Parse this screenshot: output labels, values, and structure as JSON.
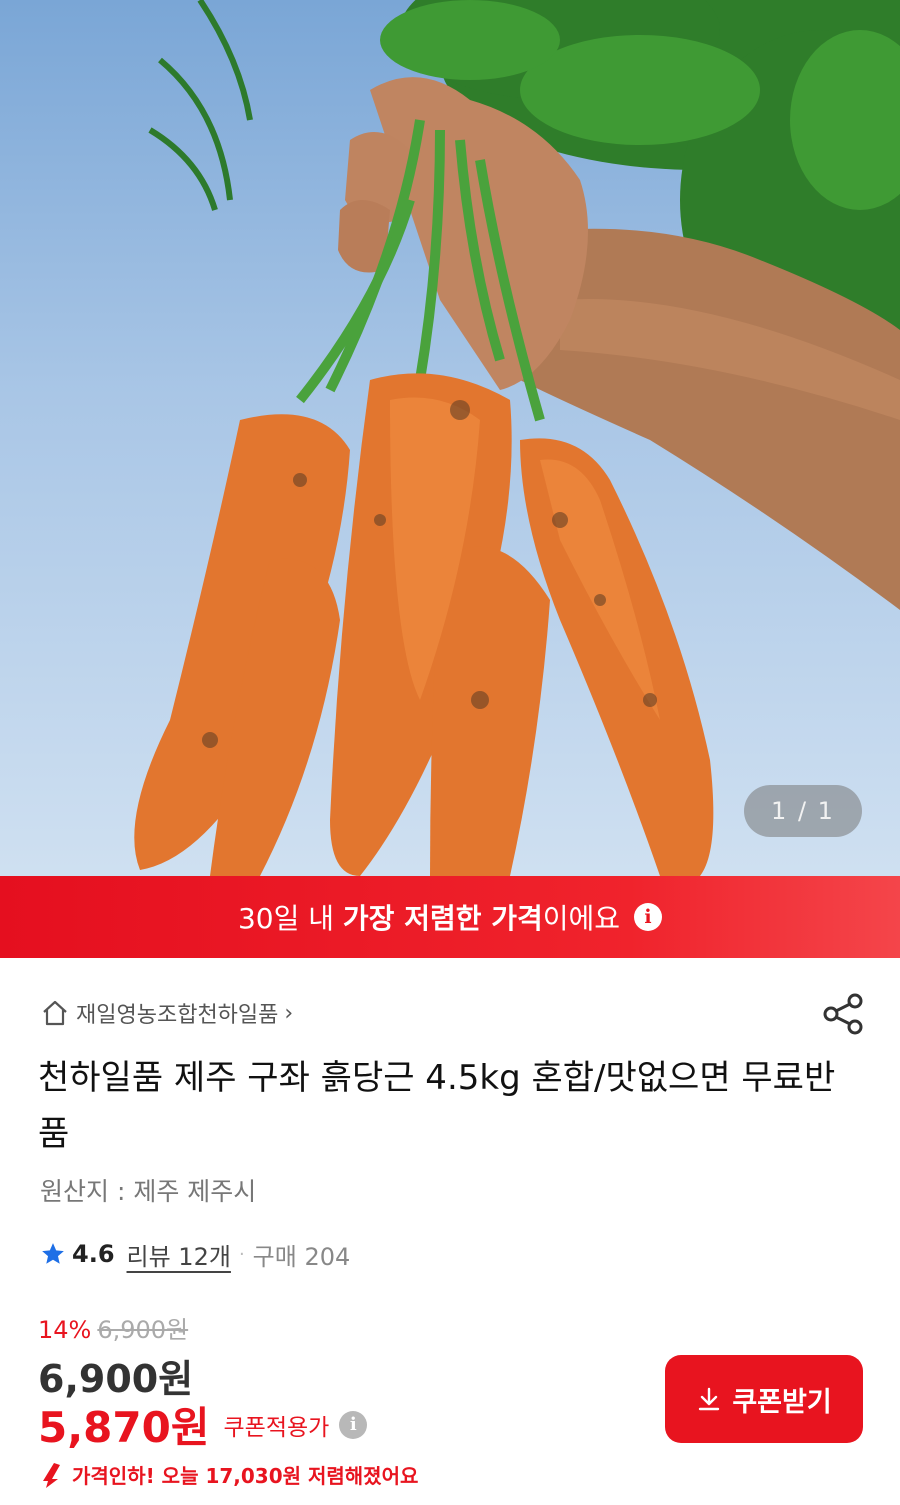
{
  "hero": {
    "counter": "1 / 1"
  },
  "banner": {
    "prefix": "30일 내 ",
    "highlight": "가장 저렴한 가격",
    "suffix": "이에요",
    "info_glyph": "i"
  },
  "store": {
    "name": "재일영농조합천하일품",
    "chevron": "›",
    "icon": "home-icon"
  },
  "share": {
    "icon": "share-icon"
  },
  "product": {
    "title": "천하일품 제주 구좌 흙당근 4.5kg 혼합/맛없으면 무료반품",
    "origin": "원산지 : 제주 제주시"
  },
  "rating": {
    "score": "4.6",
    "reviews": "리뷰 12개",
    "separator": "·",
    "purchases": "구매 204"
  },
  "pricing": {
    "discount_pct": "14%",
    "original_price": "6,900원",
    "price": "6,900원",
    "coupon_price": "5,870원",
    "coupon_label": "쿠폰적용가",
    "info_glyph": "i",
    "drop_text": "가격인하! 오늘 17,030원 저렴해졌어요"
  },
  "coupon_button": {
    "label": "쿠폰받기"
  },
  "colors": {
    "accent": "#e8141f",
    "star": "#1e6fe6"
  }
}
